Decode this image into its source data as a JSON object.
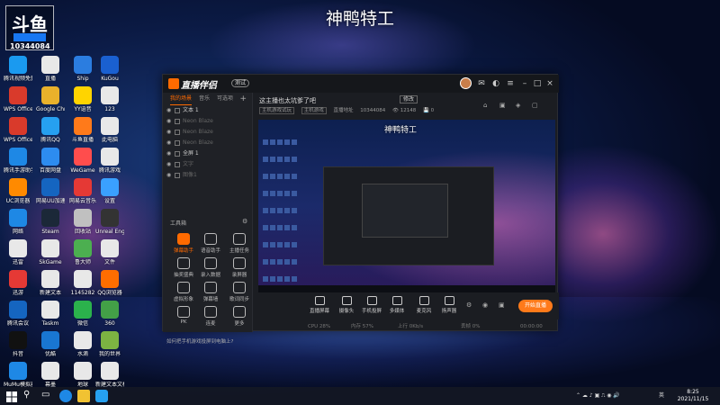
{
  "stream_title": "神鸭特工",
  "logo": {
    "mark": "斗鱼",
    "tag": "",
    "room_number": "10344084"
  },
  "desktop_icons": [
    {
      "label": "10344084",
      "color": "#1877f2"
    },
    {
      "label": "腾讯视频免费看",
      "color": "#1a9af0"
    },
    {
      "label": "直播",
      "color": "#e8e8e8"
    },
    {
      "label": "Ship",
      "color": "#2b7de0"
    },
    {
      "label": "KuGou",
      "color": "#1a60d0"
    },
    {
      "label": "WPS Office",
      "color": "#d93a2b"
    },
    {
      "label": "Google Chrome",
      "color": "#e9b12b"
    },
    {
      "label": "YY语音",
      "color": "#ffd400"
    },
    {
      "label": "123",
      "color": "#e8e8e8"
    },
    {
      "label": "WPS Office",
      "color": "#d93a2b"
    },
    {
      "label": "腾讯QQ",
      "color": "#26a0f0"
    },
    {
      "label": "斗鱼直播",
      "color": "#ff7a1a"
    },
    {
      "label": "此电脑",
      "color": "#e8e8e8"
    },
    {
      "label": "腾讯手游助手",
      "color": "#1e88e5"
    },
    {
      "label": "百度网盘",
      "color": "#2d8cf0"
    },
    {
      "label": "WeGame",
      "color": "#ff4d4d"
    },
    {
      "label": "腾讯游戏",
      "color": "#e8e8e8"
    },
    {
      "label": "UC浏览器",
      "color": "#ff8a00"
    },
    {
      "label": "网易UU加速",
      "color": "#1565c0"
    },
    {
      "label": "网易云音乐",
      "color": "#e53935"
    },
    {
      "label": "设置",
      "color": "#3aa0ff"
    },
    {
      "label": "网络",
      "color": "#1e88e5"
    },
    {
      "label": "Steam",
      "color": "#1b2838"
    },
    {
      "label": "回收站",
      "color": "#c0c0c0"
    },
    {
      "label": "Unreal Engine",
      "color": "#333333"
    },
    {
      "label": "迅雷",
      "color": "#e8e8e8"
    },
    {
      "label": "SkGame",
      "color": "#e8e8e8"
    },
    {
      "label": "鲁大师",
      "color": "#4caf50"
    },
    {
      "label": "文件",
      "color": "#e8e8e8"
    },
    {
      "label": "迅游",
      "color": "#e53935"
    },
    {
      "label": "新建文本",
      "color": "#e8e8e8"
    },
    {
      "label": "1145282",
      "color": "#e8e8e8"
    },
    {
      "label": "QQ浏览器",
      "color": "#ff6d00"
    },
    {
      "label": "腾讯会议",
      "color": "#1565c0"
    },
    {
      "label": "Taskm",
      "color": "#e8e8e8"
    },
    {
      "label": "微信",
      "color": "#2bb24c"
    },
    {
      "label": "360",
      "color": "#43a047"
    },
    {
      "label": "抖音",
      "color": "#111111"
    },
    {
      "label": "优酷",
      "color": "#1976d2"
    },
    {
      "label": "水滴",
      "color": "#e8e8e8"
    },
    {
      "label": "我的世界",
      "color": "#7cb342"
    },
    {
      "label": "MuMu模拟器",
      "color": "#1e88e5"
    },
    {
      "label": "幕墨",
      "color": "#e8e8e8"
    },
    {
      "label": "地球",
      "color": "#e8e8e8"
    },
    {
      "label": "新建文本文档",
      "color": "#e8e8e8"
    }
  ],
  "app": {
    "brand": "直播伴侣",
    "version": "测试",
    "side_tabs": [
      "我的场景",
      "音乐",
      "可选项"
    ],
    "scenes": [
      {
        "name": "文本 1",
        "dim": false
      },
      {
        "name": "Neon Blaze",
        "dim": true
      },
      {
        "name": "Neon Blaze",
        "dim": true
      },
      {
        "name": "Neon Blaze",
        "dim": true
      },
      {
        "name": "全屏 1",
        "dim": false
      },
      {
        "name": "文字",
        "dim": true
      },
      {
        "name": "图像1",
        "dim": true
      }
    ],
    "tools_title": "工具箱",
    "tools": [
      {
        "label": "弹幕助手",
        "hl": true
      },
      {
        "label": "语音助手",
        "hl": false
      },
      {
        "label": "主播任务",
        "hl": false
      },
      {
        "label": "抽奖盛典",
        "hl": false
      },
      {
        "label": "录入数据",
        "hl": false
      },
      {
        "label": "录屏器",
        "hl": false
      },
      {
        "label": "虚拟形象",
        "hl": false
      },
      {
        "label": "弹幕墙",
        "hl": false
      },
      {
        "label": "歌词同步",
        "hl": false
      },
      {
        "label": "PK",
        "hl": false
      },
      {
        "label": "连麦",
        "hl": false
      },
      {
        "label": "更多",
        "hl": false
      }
    ],
    "side_tip": "如何把手机游戏投屏到电脑上?",
    "room_title": "这主播也太坑爹了吧",
    "room_edit": "修改",
    "room_meta": [
      "主机游戏试玩",
      "主机游戏",
      "直播地址",
      "10344084",
      "👁 12148",
      "💾 0"
    ],
    "preview_title": "神鸭特工",
    "toolbar_buttons": [
      "直播屏幕",
      "摄像头",
      "手机投屏",
      "多媒体",
      "麦克风",
      "扬声器"
    ],
    "go_live": "开始直播",
    "status": [
      "CPU 28%",
      "内存 57%",
      "上行 0Kb/s",
      "丢帧 0%",
      "00:00:00"
    ]
  },
  "taskbar": {
    "tray_text": "英",
    "time": "8:25",
    "date": "2021/11/15"
  }
}
